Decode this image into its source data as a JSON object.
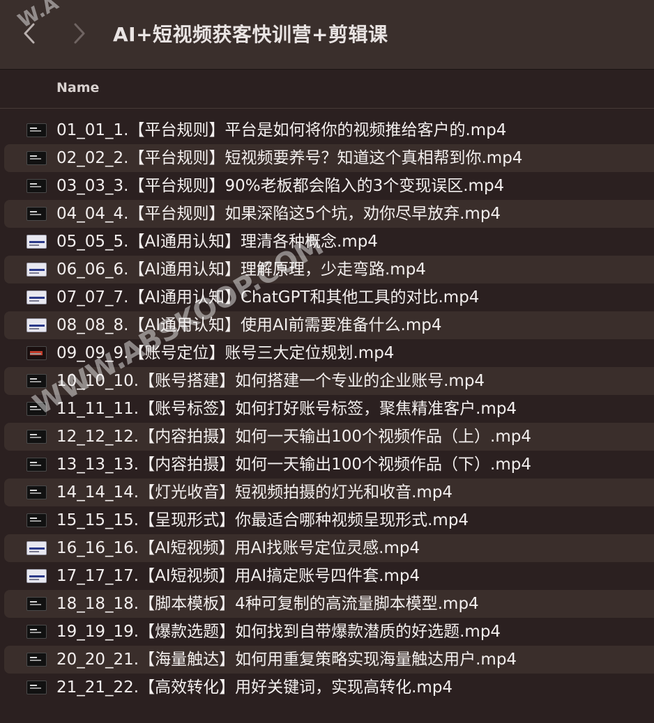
{
  "toolbar": {
    "title": "AI+短视频获客快训营+剪辑课",
    "back_icon": "chevron-left-icon",
    "forward_icon": "chevron-right-icon"
  },
  "header": {
    "name_column": "Name"
  },
  "watermark": {
    "main": "WWW.ABSKOOP.COM",
    "corner": "W.A"
  },
  "files": [
    {
      "name": "01_01_1.【平台规则】平台是如何将你的视频推给客户的.mp4",
      "icon": "dark"
    },
    {
      "name": "02_02_2.【平台规则】短视频要养号？知道这个真相帮到你.mp4",
      "icon": "dark"
    },
    {
      "name": "03_03_3.【平台规则】90%老板都会陷入的3个变现误区.mp4",
      "icon": "dark"
    },
    {
      "name": "04_04_4.【平台规则】如果深陷这5个坑，劝你尽早放弃.mp4",
      "icon": "dark"
    },
    {
      "name": "05_05_5.【AI通用认知】理清各种概念.mp4",
      "icon": "light"
    },
    {
      "name": "06_06_6.【AI通用认知】理解原理，少走弯路.mp4",
      "icon": "light"
    },
    {
      "name": "07_07_7.【AI通用认知】ChatGPT和其他工具的对比.mp4",
      "icon": "light"
    },
    {
      "name": "08_08_8.【AI通用认知】使用AI前需要准备什么.mp4",
      "icon": "light"
    },
    {
      "name": "09_09_9.【账号定位】账号三大定位规划.mp4",
      "icon": "red"
    },
    {
      "name": "10_10_10.【账号搭建】如何搭建一个专业的企业账号.mp4",
      "icon": "dark"
    },
    {
      "name": "11_11_11.【账号标签】如何打好账号标签，聚焦精准客户.mp4",
      "icon": "dark"
    },
    {
      "name": "12_12_12.【内容拍摄】如何一天输出100个视频作品（上）.mp4",
      "icon": "dark"
    },
    {
      "name": "13_13_13.【内容拍摄】如何一天输出100个视频作品（下）.mp4",
      "icon": "dark"
    },
    {
      "name": "14_14_14.【灯光收音】短视频拍摄的灯光和收音.mp4",
      "icon": "dark"
    },
    {
      "name": "15_15_15.【呈现形式】你最适合哪种视频呈现形式.mp4",
      "icon": "dark"
    },
    {
      "name": "16_16_16.【AI短视频】用AI找账号定位灵感.mp4",
      "icon": "light"
    },
    {
      "name": "17_17_17.【AI短视频】用AI搞定账号四件套.mp4",
      "icon": "light"
    },
    {
      "name": "18_18_18.【脚本模板】4种可复制的高流量脚本模型.mp4",
      "icon": "dark"
    },
    {
      "name": "19_19_19.【爆款选题】如何找到自带爆款潜质的好选题.mp4",
      "icon": "dark"
    },
    {
      "name": "20_20_21.【海量触达】如何用重复策略实现海量触达用户.mp4",
      "icon": "dark"
    },
    {
      "name": "21_21_22.【高效转化】用好关键词，实现高转化.mp4",
      "icon": "dark"
    }
  ]
}
